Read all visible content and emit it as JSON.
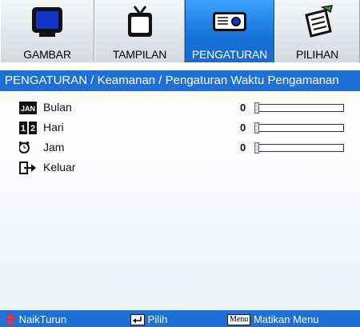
{
  "tabs": [
    {
      "label": "GAMBAR",
      "icon": "monitor-icon",
      "active": false
    },
    {
      "label": "TAMPILAN",
      "icon": "tv-icon",
      "active": false
    },
    {
      "label": "PENGATURAN",
      "icon": "projector-icon",
      "active": true
    },
    {
      "label": "PILIHAN",
      "icon": "notepad-pen-icon",
      "active": false
    }
  ],
  "breadcrumb": "PENGATURAN / Keamanan / Pengaturan Waktu Pengamanan",
  "rows": [
    {
      "icon": "calendar-month-icon",
      "icon_text": "JAN",
      "label": "Bulan",
      "value": "0",
      "fill": 0
    },
    {
      "icon": "calendar-day-icon",
      "icon_text": "12",
      "label": "Hari",
      "value": "0",
      "fill": 0
    },
    {
      "icon": "alarm-clock-icon",
      "label": "Jam",
      "value": "0",
      "fill": 0
    },
    {
      "icon": "exit-icon",
      "label": "Keluar"
    }
  ],
  "footer": {
    "nav_label": "NaikTurun",
    "select_label": "Pilih",
    "menu_key": "Menu",
    "menu_label": "Matikan Menu"
  },
  "colors": {
    "accent": "#1e6fd6",
    "active_tab": "#1471d8"
  }
}
